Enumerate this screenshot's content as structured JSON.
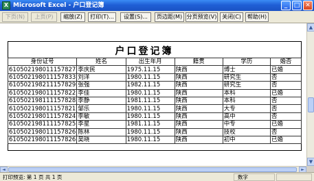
{
  "window": {
    "title": "Microsoft Excel - 户口登记簿",
    "app_icon": "excel-icon",
    "buttons": {
      "minimize": "_",
      "maximize": "□",
      "close": "✕"
    }
  },
  "toolbar": {
    "next": "下页(N)",
    "prev": "上页(P)",
    "zoom": "缩放(Z)",
    "print": "打印(T)...",
    "setup": "设置(S)...",
    "margins": "页边距(M)",
    "page_break": "分页预览(V)",
    "close": "关闭(C)",
    "help": "帮助(H)"
  },
  "sheet": {
    "title": "户口登记簿",
    "headers": [
      "身份证号",
      "姓名",
      "出生年月",
      "籍贯",
      "学历",
      "婚否"
    ],
    "rows": [
      [
        "610502198011157827",
        "李庆民",
        "1975.11.15",
        "陕西",
        "博士",
        "已婚"
      ],
      [
        "610502198011157833",
        "刘洋",
        "1980.11.15",
        "陕西",
        "研究生",
        "否"
      ],
      [
        "610502198211157829",
        "张强",
        "1982.11.15",
        "陕西",
        "研究生",
        "否"
      ],
      [
        "610502198011157822",
        "李佳",
        "1980.11.15",
        "陕西",
        "本科",
        "已婚"
      ],
      [
        "610502198111157828",
        "李静",
        "1981.11.15",
        "陕西",
        "本科",
        "否"
      ],
      [
        "610502198011157821",
        "邹乐",
        "1980.11.15",
        "陕西",
        "大专",
        "否"
      ],
      [
        "610502198011157824",
        "李敏",
        "1980.11.15",
        "陕西",
        "高中",
        "否"
      ],
      [
        "610502198111157825",
        "李星",
        "1981.11.15",
        "陕西",
        "中专",
        "已婚"
      ],
      [
        "610502198011157826",
        "陈林",
        "1980.11.15",
        "陕西",
        "技校",
        "否"
      ],
      [
        "610502198011157826",
        "吴晓",
        "1980.11.15",
        "陕西",
        "初中",
        "已婚"
      ]
    ]
  },
  "status": {
    "left": "打印预览: 第 1 页  共 1 页",
    "right": "数字"
  },
  "scroll": {
    "up": "▲",
    "down": "▼",
    "left": "◄",
    "right": "►"
  }
}
